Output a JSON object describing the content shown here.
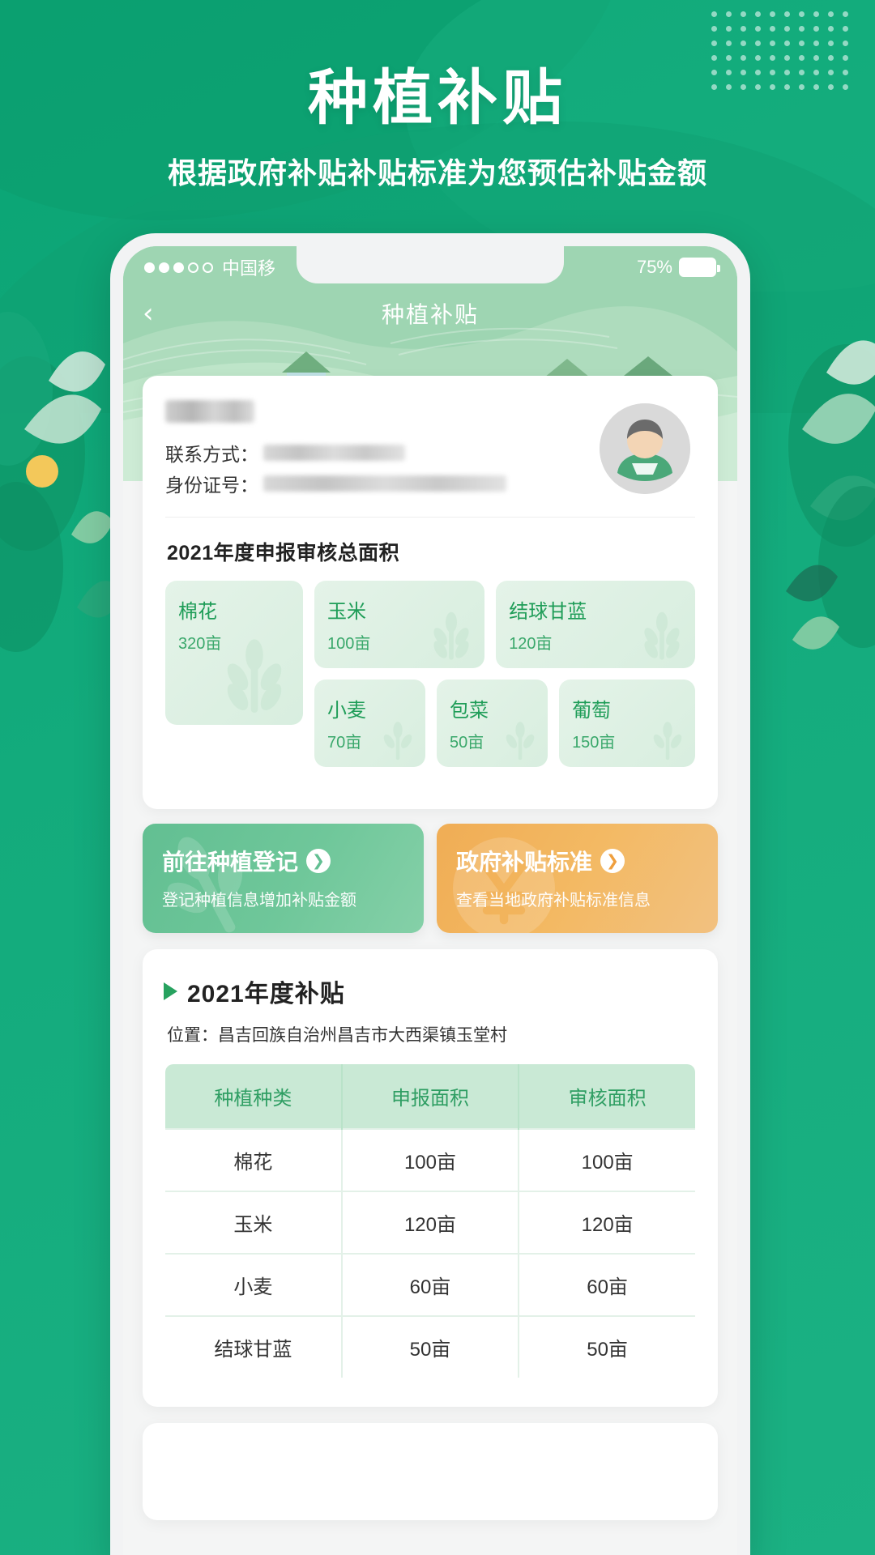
{
  "hero": {
    "title": "种植补贴",
    "subtitle": "根据政府补贴补贴标准为您预估补贴金额"
  },
  "theme": {
    "brand_green": "#11a673",
    "header_green": "#8fcfa7",
    "tile_green": "#e4f3e8",
    "crop_text_green": "#1f9d58",
    "btn_green": "#62bf92",
    "btn_orange": "#f0ad55",
    "table_header_bg": "#c9e9d5"
  },
  "status_bar": {
    "signal_dots_filled": 3,
    "signal_dots_empty": 2,
    "carrier": "中国移",
    "battery_percent": "75%",
    "battery_icon": "battery-icon"
  },
  "nav": {
    "back_icon": "chevron-left-icon",
    "title": "种植补贴"
  },
  "user_card": {
    "name_value": "",
    "contact_label": "联系方式：",
    "contact_value": "",
    "id_label": "身份证号：",
    "id_value": "",
    "avatar_icon": "avatar-icon"
  },
  "areas": {
    "title": "2021年度申报审核总面积",
    "unit_icon": "wheat-leaf-icon",
    "tiles": [
      {
        "name": "棉花",
        "area": "320亩",
        "size": "big"
      },
      {
        "name": "玉米",
        "area": "100亩",
        "size": "wide"
      },
      {
        "name": "结球甘蓝",
        "area": "120亩",
        "size": "wide"
      },
      {
        "name": "小麦",
        "area": "70亩",
        "size": "small"
      },
      {
        "name": "包菜",
        "area": "50亩",
        "size": "small"
      },
      {
        "name": "葡萄",
        "area": "150亩",
        "size": "medium"
      }
    ]
  },
  "actions": [
    {
      "id": "register",
      "title": "前往种植登记",
      "subtitle": "登记种植信息增加补贴金额",
      "arrow_icon": "arrow-right-circle-icon"
    },
    {
      "id": "standard",
      "title": "政府补贴标准",
      "subtitle": "查看当地政府补贴标准信息",
      "arrow_icon": "arrow-right-circle-icon"
    }
  ],
  "subsidy": {
    "marker_icon": "play-triangle-icon",
    "year_title": "2021年度补贴",
    "location_label": "位置：",
    "location_value": "昌吉回族自治州昌吉市大西渠镇玉堂村",
    "table": {
      "headers": [
        "种植种类",
        "申报面积",
        "审核面积"
      ],
      "rows": [
        [
          "棉花",
          "100亩",
          "100亩"
        ],
        [
          "玉米",
          "120亩",
          "120亩"
        ],
        [
          "小麦",
          "60亩",
          "60亩"
        ],
        [
          "结球甘蓝",
          "50亩",
          "50亩"
        ]
      ]
    }
  }
}
